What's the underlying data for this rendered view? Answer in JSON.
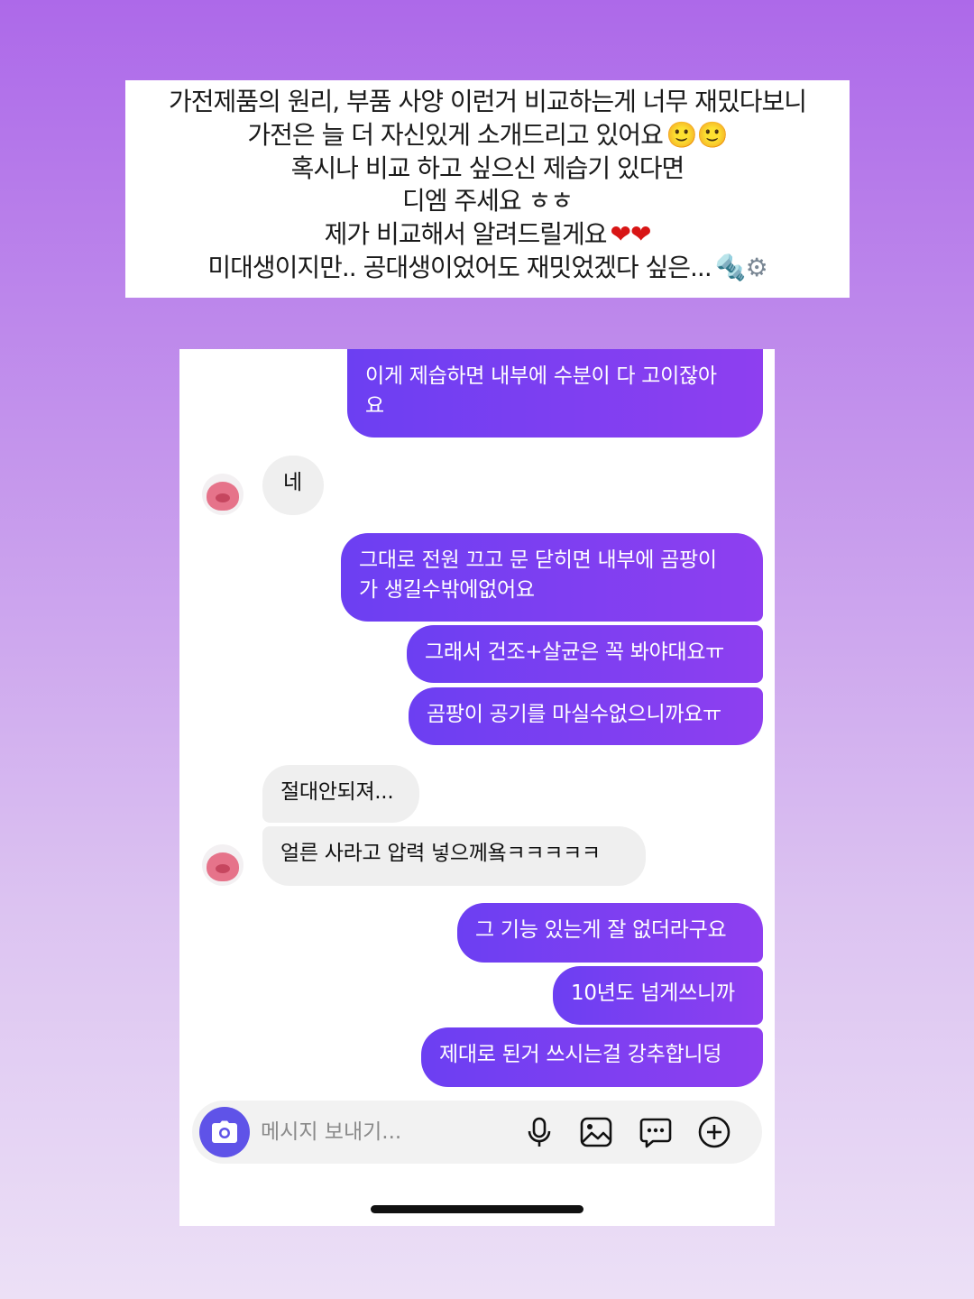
{
  "caption": {
    "lines": [
      "가전제품의 원리, 부품 사양 이런거 비교하는게 너무 재밌다보니",
      "가전은 늘 더 자신있게 소개드리고 있어요",
      "혹시나 비교 하고 싶으신 제습기 있다면",
      "디엠 주세요 ㅎㅎ",
      "제가 비교해서 알려드릴게요",
      "미대생이지만.. 공대생이었어도 재밋었겠다 싶은..."
    ],
    "emoji": {
      "smiles": "🙂🙂",
      "hearts": "❤❤",
      "tools": "🔩⚙"
    }
  },
  "messages": [
    {
      "side": "out",
      "text": "이게 제습하면 내부에 수분이 다 고이잖아\n요"
    },
    {
      "side": "in",
      "text": "네"
    },
    {
      "side": "out",
      "text": "그대로 전원 끄고 문 닫히면 내부에 곰팡이\n가 생길수밖에없어요"
    },
    {
      "side": "out",
      "text": "그래서 건조+살균은 꼭 봐야대요ㅠ"
    },
    {
      "side": "out",
      "text": "곰팡이 공기를 마실수없으니까요ㅠ"
    },
    {
      "side": "in",
      "text": "절대안되져..."
    },
    {
      "side": "in",
      "text": "얼른 사라고 압력 넣으께욬ㅋㅋㅋㅋㅋ"
    },
    {
      "side": "out",
      "text": "그 기능 있는게 잘 없더라구요"
    },
    {
      "side": "out",
      "text": "10년도 넘게쓰니까"
    },
    {
      "side": "out",
      "text": "제대로 된거 쓰시는걸 강추합니덩"
    }
  ],
  "composer": {
    "placeholder": "메시지 보내기..."
  },
  "colors": {
    "outgoing_bubble_start": "#6c3ff2",
    "outgoing_bubble_end": "#8e3ff0",
    "incoming_bubble": "#efefef",
    "camera_button": "#5f53e8"
  }
}
